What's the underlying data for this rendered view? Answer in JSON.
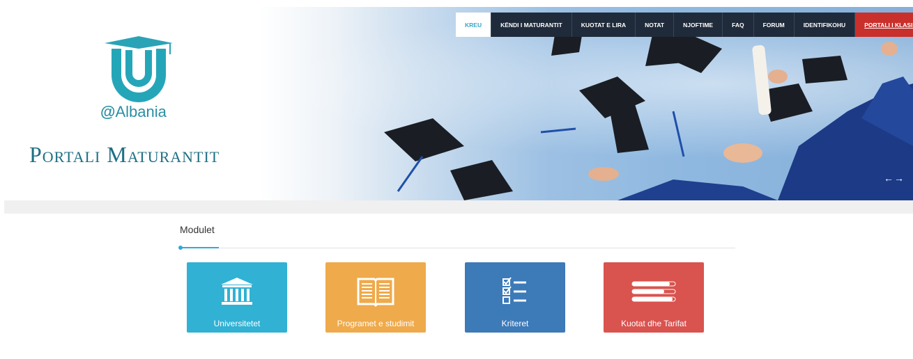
{
  "brand": {
    "logo_text": "Albania",
    "logo_at": "@",
    "portal_title": "Portali Maturantit"
  },
  "nav": {
    "items": [
      {
        "label": "KREU",
        "state": "active"
      },
      {
        "label": "KËNDI I MATURANTIT",
        "state": "normal"
      },
      {
        "label": "KUOTAT E LIRA",
        "state": "normal"
      },
      {
        "label": "NOTAT",
        "state": "normal"
      },
      {
        "label": "NJOFTIME",
        "state": "normal"
      },
      {
        "label": "FAQ",
        "state": "normal"
      },
      {
        "label": "FORUM",
        "state": "normal"
      },
      {
        "label": "IDENTIFIKOHU",
        "state": "normal"
      },
      {
        "label": "PORTALI I KLASIFIKIMIT",
        "state": "highlight"
      }
    ]
  },
  "slider": {
    "arrows": "←→"
  },
  "modules": {
    "title": "Modulet",
    "tiles": [
      {
        "label": "Universitetet",
        "icon": "university-icon",
        "color": "#31b1d4"
      },
      {
        "label": "Programet e studimit",
        "icon": "book-icon",
        "color": "#efaa4b"
      },
      {
        "label": "Kriteret",
        "icon": "checklist-icon",
        "color": "#3d7ab8"
      },
      {
        "label": "Kuotat dhe Tarifat",
        "icon": "bars-icon",
        "color": "#d9534f"
      }
    ]
  },
  "colors": {
    "accent": "#2eaad8",
    "nav_bg": "#1f2b3a",
    "highlight": "#c9302c",
    "brand": "#1e6f84"
  }
}
